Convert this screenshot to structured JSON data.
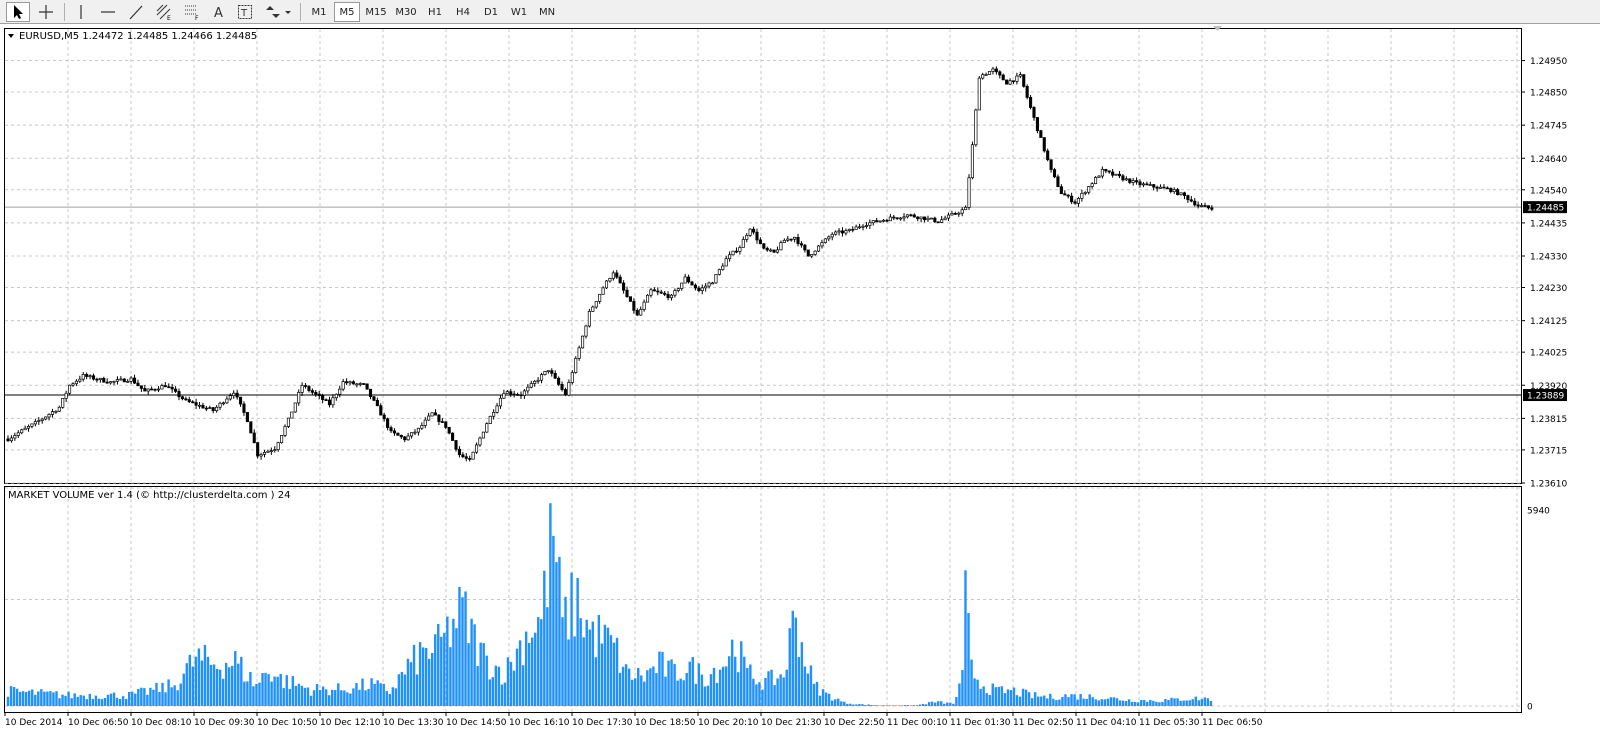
{
  "toolbar": {
    "tools": [
      {
        "name": "cursor-tool-button",
        "icon": "arrow-cursor-icon"
      },
      {
        "name": "crosshair-tool-button",
        "icon": "crosshair-icon"
      },
      {
        "name": "vertical-line-tool-button",
        "icon": "vertical-line-icon"
      },
      {
        "name": "horizontal-line-tool-button",
        "icon": "horizontal-line-icon"
      },
      {
        "name": "trendline-tool-button",
        "icon": "trendline-icon"
      },
      {
        "name": "equidistant-channel-tool-button",
        "icon": "channel-icon"
      },
      {
        "name": "fibonacci-tool-button",
        "icon": "fibonacci-icon"
      },
      {
        "name": "text-tool-button",
        "icon": "text-A-icon"
      },
      {
        "name": "text-label-tool-button",
        "icon": "text-label-icon"
      },
      {
        "name": "arrows-tool-button",
        "icon": "arrow-marks-icon"
      }
    ],
    "timeframes": [
      "M1",
      "M5",
      "M15",
      "M30",
      "H1",
      "H4",
      "D1",
      "W1",
      "MN"
    ],
    "active_timeframe": "M5"
  },
  "chart_data": [
    {
      "type": "candlestick",
      "title": "EURUSD,M5  1.24472 1.24485 1.24466 1.24485",
      "symbol": "EURUSD",
      "timeframe": "M5",
      "ohlc_header": [
        "1.24472",
        "1.24485",
        "1.24466",
        "1.24485"
      ],
      "ylim": [
        1.2361,
        1.2505
      ],
      "y_ticks": [
        "1.24950",
        "1.24850",
        "1.24745",
        "1.24640",
        "1.24540",
        "1.24435",
        "1.24330",
        "1.24230",
        "1.24125",
        "1.24025",
        "1.23920",
        "1.23815",
        "1.23715",
        "1.23610"
      ],
      "current_price": {
        "label": "1.24485",
        "value": 1.24485
      },
      "horizontal_line": {
        "label": "1.23889",
        "value": 1.23889
      },
      "grid": true,
      "keypoints": [
        [
          0,
          1.2375
        ],
        [
          8,
          1.238
        ],
        [
          15,
          1.2385
        ],
        [
          18,
          1.2392
        ],
        [
          22,
          1.2395
        ],
        [
          30,
          1.2393
        ],
        [
          36,
          1.2394
        ],
        [
          40,
          1.239
        ],
        [
          46,
          1.2392
        ],
        [
          52,
          1.2387
        ],
        [
          60,
          1.2384
        ],
        [
          66,
          1.239
        ],
        [
          70,
          1.2381
        ],
        [
          73,
          1.237
        ],
        [
          78,
          1.2372
        ],
        [
          82,
          1.2381
        ],
        [
          86,
          1.2392
        ],
        [
          90,
          1.2389
        ],
        [
          94,
          1.2386
        ],
        [
          98,
          1.2393
        ],
        [
          104,
          1.2392
        ],
        [
          108,
          1.2385
        ],
        [
          112,
          1.2377
        ],
        [
          116,
          1.2375
        ],
        [
          120,
          1.2378
        ],
        [
          124,
          1.2383
        ],
        [
          128,
          1.2379
        ],
        [
          132,
          1.237
        ],
        [
          135,
          1.2368
        ],
        [
          140,
          1.238
        ],
        [
          145,
          1.239
        ],
        [
          150,
          1.2389
        ],
        [
          154,
          1.2393
        ],
        [
          158,
          1.2397
        ],
        [
          163,
          1.2389
        ],
        [
          166,
          1.24
        ],
        [
          170,
          1.2415
        ],
        [
          174,
          1.2423
        ],
        [
          177,
          1.2428
        ],
        [
          180,
          1.2422
        ],
        [
          184,
          1.2414
        ],
        [
          188,
          1.2422
        ],
        [
          194,
          1.242
        ],
        [
          198,
          1.2426
        ],
        [
          202,
          1.2422
        ],
        [
          206,
          1.2425
        ],
        [
          210,
          1.2432
        ],
        [
          214,
          1.2436
        ],
        [
          217,
          1.2442
        ],
        [
          221,
          1.2435
        ],
        [
          224,
          1.2434
        ],
        [
          227,
          1.2438
        ],
        [
          230,
          1.2439
        ],
        [
          234,
          1.2433
        ],
        [
          237,
          1.2436
        ],
        [
          241,
          1.244
        ],
        [
          246,
          1.2441
        ],
        [
          250,
          1.2443
        ],
        [
          254,
          1.2444
        ],
        [
          258,
          1.2445
        ],
        [
          263,
          1.2446
        ],
        [
          268,
          1.2445
        ],
        [
          272,
          1.2444
        ],
        [
          276,
          1.2446
        ],
        [
          280,
          1.2448
        ],
        [
          282,
          1.2468
        ],
        [
          284,
          1.249
        ],
        [
          288,
          1.2492
        ],
        [
          292,
          1.2488
        ],
        [
          296,
          1.249
        ],
        [
          299,
          1.248
        ],
        [
          302,
          1.247
        ],
        [
          305,
          1.246
        ],
        [
          308,
          1.2453
        ],
        [
          312,
          1.245
        ],
        [
          316,
          1.2455
        ],
        [
          320,
          1.246
        ],
        [
          325,
          1.2458
        ],
        [
          330,
          1.2456
        ],
        [
          335,
          1.2455
        ],
        [
          340,
          1.2454
        ],
        [
          344,
          1.2452
        ],
        [
          348,
          1.2449
        ],
        [
          352,
          1.2448
        ]
      ]
    },
    {
      "type": "bar",
      "title": "MARKET VOLUME ver 1.4 (© http://clusterdelta.com ) 24",
      "ylim": [
        0,
        5940
      ],
      "y_ticks": [
        "5940",
        "0"
      ],
      "bar_color": "#1e90ff",
      "keypoints": [
        [
          0,
          500
        ],
        [
          20,
          360
        ],
        [
          40,
          360
        ],
        [
          55,
          700
        ],
        [
          62,
          1600
        ],
        [
          68,
          1400
        ],
        [
          75,
          1500
        ],
        [
          82,
          700
        ],
        [
          86,
          1250
        ],
        [
          90,
          900
        ],
        [
          100,
          560
        ],
        [
          110,
          560
        ],
        [
          120,
          720
        ],
        [
          126,
          500
        ],
        [
          132,
          1300
        ],
        [
          136,
          1700
        ],
        [
          142,
          2000
        ],
        [
          150,
          3200
        ],
        [
          154,
          2200
        ],
        [
          158,
          1500
        ],
        [
          164,
          1100
        ],
        [
          168,
          1800
        ],
        [
          172,
          2600
        ],
        [
          176,
          2900
        ],
        [
          180,
          5940
        ],
        [
          183,
          2700
        ],
        [
          186,
          3300
        ],
        [
          188,
          3500
        ],
        [
          192,
          2500
        ],
        [
          196,
          2300
        ],
        [
          200,
          2000
        ],
        [
          204,
          1100
        ],
        [
          210,
          1000
        ],
        [
          215,
          1400
        ],
        [
          220,
          1100
        ],
        [
          225,
          1300
        ],
        [
          230,
          1000
        ],
        [
          236,
          1400
        ],
        [
          240,
          2100
        ],
        [
          244,
          1100
        ],
        [
          250,
          800
        ],
        [
          256,
          1050
        ],
        [
          260,
          3200
        ],
        [
          262,
          2000
        ],
        [
          266,
          700
        ],
        [
          270,
          400
        ],
        [
          276,
          110
        ],
        [
          282,
          50
        ],
        [
          288,
          20
        ],
        [
          300,
          25
        ],
        [
          306,
          140
        ],
        [
          312,
          80
        ],
        [
          315,
          900
        ],
        [
          316,
          3600
        ],
        [
          318,
          1200
        ],
        [
          322,
          700
        ],
        [
          326,
          500
        ],
        [
          332,
          500
        ],
        [
          338,
          350
        ],
        [
          344,
          300
        ],
        [
          350,
          350
        ],
        [
          360,
          300
        ],
        [
          370,
          200
        ],
        [
          380,
          180
        ],
        [
          390,
          250
        ],
        [
          396,
          250
        ]
      ],
      "x_ticks": [
        "10 Dec 2014",
        "10 Dec 06:50",
        "10 Dec 08:10",
        "10 Dec 09:30",
        "10 Dec 10:50",
        "10 Dec 12:10",
        "10 Dec 13:30",
        "10 Dec 14:50",
        "10 Dec 16:10",
        "10 Dec 17:30",
        "10 Dec 18:50",
        "10 Dec 20:10",
        "10 Dec 21:30",
        "10 Dec 22:50",
        "11 Dec 00:10",
        "11 Dec 01:30",
        "11 Dec 02:50",
        "11 Dec 04:10",
        "11 Dec 05:30",
        "11 Dec 06:50"
      ]
    }
  ]
}
